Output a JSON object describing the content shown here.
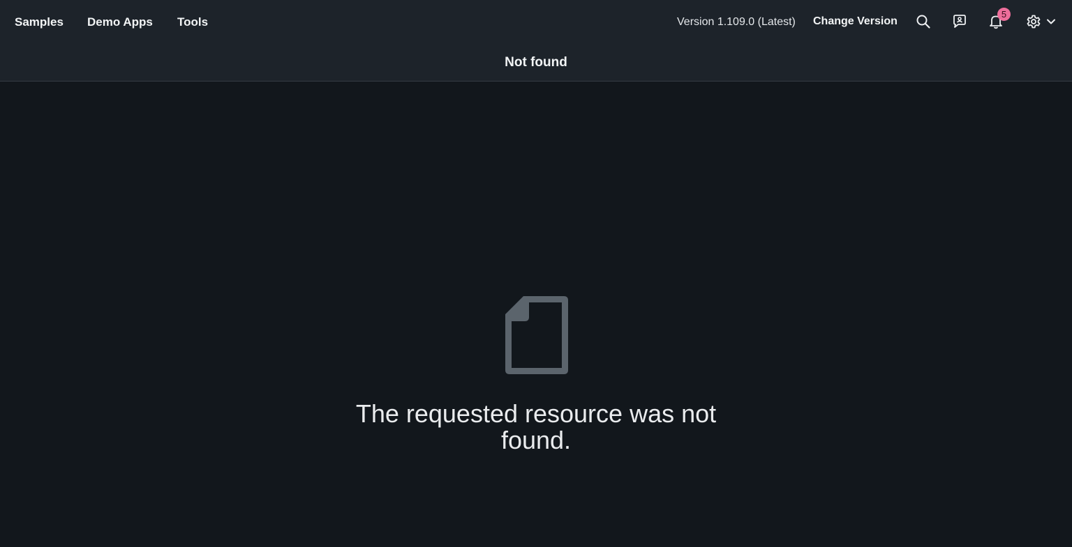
{
  "topbar": {
    "nav": [
      {
        "label": "Samples"
      },
      {
        "label": "Demo Apps"
      },
      {
        "label": "Tools"
      }
    ],
    "version_text": "Version 1.109.0 (Latest)",
    "change_version_label": "Change Version",
    "icons": {
      "search": "search-icon",
      "feedback": "feedback-icon",
      "notifications": "bell-icon",
      "settings": "gear-icon",
      "settings_menu": "chevron-down-icon"
    },
    "notification_count": "5",
    "badge_color": "#ee6e9b"
  },
  "page": {
    "title": "Not found"
  },
  "content": {
    "icon": "document-icon",
    "message": "The requested resource was not found."
  },
  "colors": {
    "shell_bg": "#1d232a",
    "content_bg": "#12171c",
    "icon_gray": "#5b646c",
    "text": "#eaecee"
  }
}
